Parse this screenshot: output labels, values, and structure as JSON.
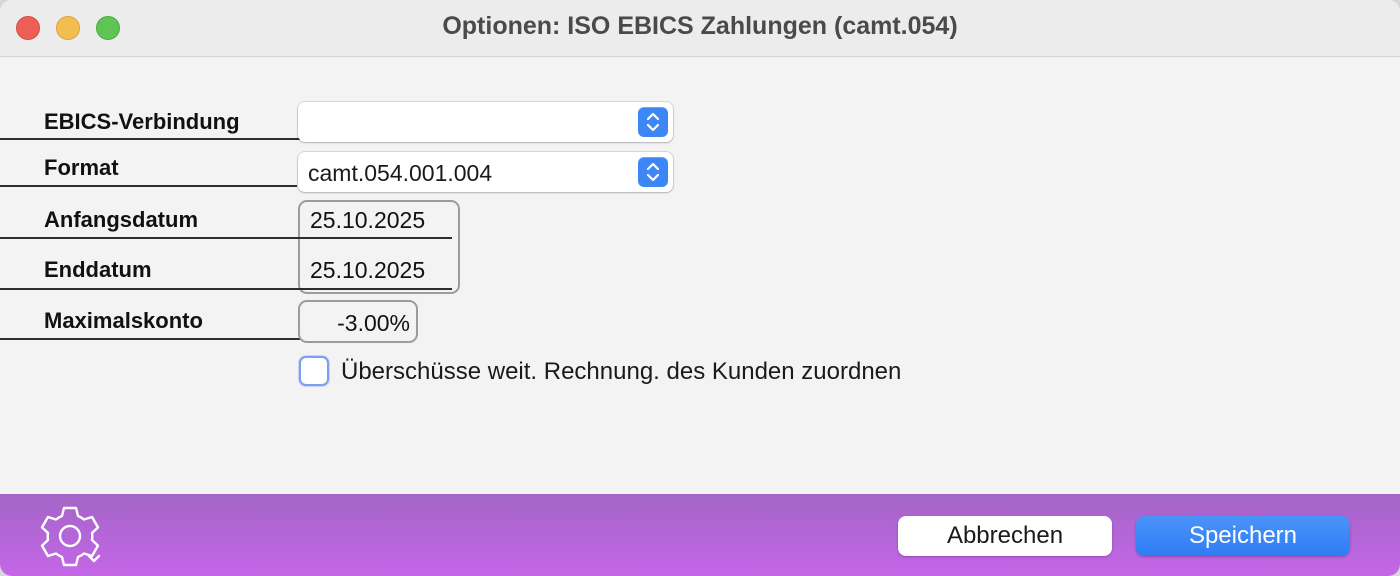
{
  "window": {
    "title": "Optionen: ISO EBICS Zahlungen (camt.054)"
  },
  "form": {
    "ebics_connection": {
      "label": "EBICS-Verbindung",
      "value": ""
    },
    "format": {
      "label": "Format",
      "value": "camt.054.001.004"
    },
    "start_date": {
      "label": "Anfangsdatum",
      "value": "25.10.2025"
    },
    "end_date": {
      "label": "Enddatum",
      "value": "25.10.2025"
    },
    "max_discount": {
      "label": "Maximalskonto",
      "value": "-3.00%"
    },
    "surplus_checkbox": {
      "label": "Überschüsse weit. Rechnung. des Kunden zuordnen",
      "checked": false
    }
  },
  "footer": {
    "settings_icon": "gear-icon",
    "cancel_label": "Abbrechen",
    "save_label": "Speichern"
  },
  "colors": {
    "accent": "#3d86f5",
    "footer_gradient_top": "#a465c6",
    "footer_gradient_bottom": "#c466e8"
  }
}
